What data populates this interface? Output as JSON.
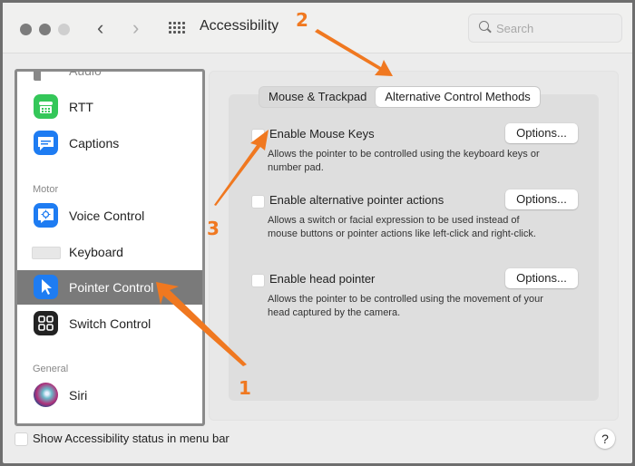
{
  "window": {
    "title": "Accessibility",
    "search": {
      "placeholder": "Search",
      "value": ""
    }
  },
  "sidebar": {
    "items": [
      {
        "label": "Audio",
        "icon": "speaker-icon",
        "partial": true
      },
      {
        "label": "RTT",
        "icon": "rtt-phone-icon",
        "color": "#34c759"
      },
      {
        "label": "Captions",
        "icon": "captions-icon",
        "color": "#1e7cf2"
      },
      {
        "section": "Motor"
      },
      {
        "label": "Voice Control",
        "icon": "voice-control-icon",
        "color": "#1e7cf2"
      },
      {
        "label": "Keyboard",
        "icon": "keyboard-icon"
      },
      {
        "label": "Pointer Control",
        "icon": "pointer-icon",
        "color": "#1e7cf2",
        "selected": true
      },
      {
        "label": "Switch Control",
        "icon": "switch-control-icon",
        "color": "#222222"
      },
      {
        "section": "General"
      },
      {
        "label": "Siri",
        "icon": "siri-icon"
      }
    ],
    "sections": {
      "motor": "Motor",
      "general": "General"
    }
  },
  "tabs": [
    {
      "label": "Mouse & Trackpad",
      "active": false
    },
    {
      "label": "Alternative Control Methods",
      "active": true
    }
  ],
  "options": [
    {
      "label": "Enable Mouse Keys",
      "checked": false,
      "description": "Allows the pointer to be controlled using the keyboard keys or number pad.",
      "button": "Options..."
    },
    {
      "label": "Enable alternative pointer actions",
      "checked": false,
      "description": "Allows a switch or facial expression to be used instead of mouse buttons or pointer actions like left-click and right-click.",
      "button": "Options..."
    },
    {
      "label": "Enable head pointer",
      "checked": false,
      "description": "Allows the pointer to be controlled using the movement of your head captured by the camera.",
      "button": "Options..."
    }
  ],
  "footer": {
    "checkbox_label": "Show Accessibility status in menu bar",
    "checked": false,
    "help": "?"
  },
  "annotations": {
    "one": "1",
    "two": "2",
    "three": "3",
    "color": "#f07820"
  }
}
